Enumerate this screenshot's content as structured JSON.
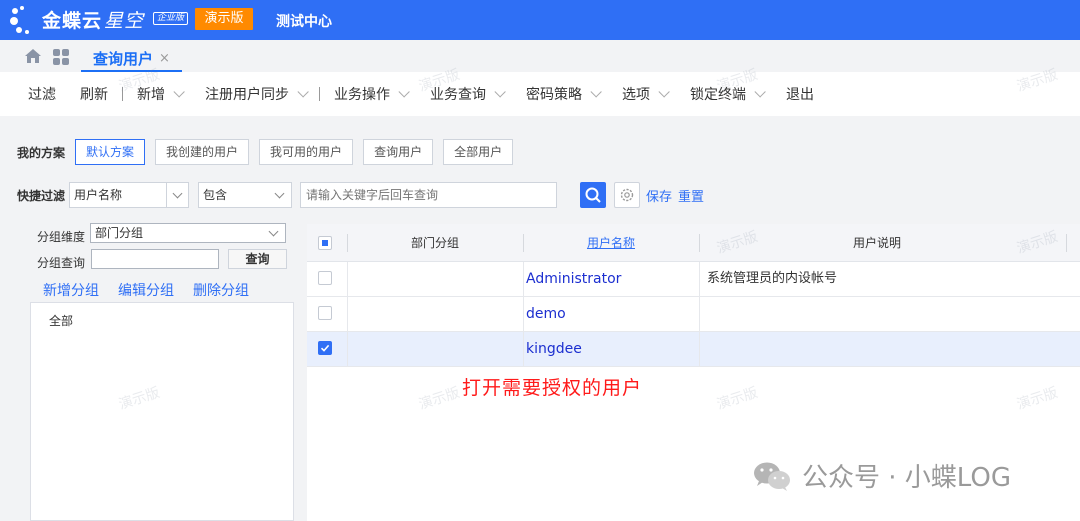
{
  "topbar": {
    "brand_main": "金蝶云",
    "brand_sub": "星空",
    "edition_badge": "企业版",
    "demo_badge": "演示版",
    "center_title": "测试中心",
    "bg_color": "#2f6ff5",
    "badge_color": "#ff8a00"
  },
  "tabs": {
    "home_icon": "home-icon",
    "apps_icon": "apps-grid-icon",
    "active_tab": "查询用户",
    "close_glyph": "×"
  },
  "toolbar": {
    "items": [
      {
        "label": "过滤",
        "dropdown": false
      },
      {
        "label": "刷新",
        "dropdown": false
      },
      {
        "label": "新增",
        "dropdown": true
      },
      {
        "label": "注册用户同步",
        "dropdown": true
      },
      {
        "label": "业务操作",
        "dropdown": true
      },
      {
        "label": "业务查询",
        "dropdown": true
      },
      {
        "label": "密码策略",
        "dropdown": true
      },
      {
        "label": "选项",
        "dropdown": true
      },
      {
        "label": "锁定终端",
        "dropdown": true
      },
      {
        "label": "退出",
        "dropdown": false
      }
    ]
  },
  "scheme": {
    "label": "我的方案",
    "buttons": [
      "默认方案",
      "我创建的用户",
      "我可用的用户",
      "查询用户",
      "全部用户"
    ],
    "active_index": 0
  },
  "quick_filter": {
    "label": "快捷过滤",
    "field": "用户名称",
    "operator": "包含",
    "placeholder": "请输入关键字后回车查询",
    "save": "保存",
    "reset": "重置"
  },
  "group_panel": {
    "dimension_label": "分组维度",
    "dimension_value": "部门分组",
    "query_label": "分组查询",
    "query_value": "",
    "query_button": "查询",
    "actions": [
      "新增分组",
      "编辑分组",
      "删除分组"
    ],
    "tree_root": "全部"
  },
  "grid": {
    "columns": [
      "部门分组",
      "用户名称",
      "用户说明"
    ],
    "rows": [
      {
        "dept": "",
        "name": "Administrator",
        "desc": "系统管理员的内设帐号",
        "checked": false
      },
      {
        "dept": "",
        "name": "demo",
        "desc": "",
        "checked": false
      },
      {
        "dept": "",
        "name": "kingdee",
        "desc": "",
        "checked": true
      }
    ]
  },
  "annotation": "打开需要授权的用户",
  "watermark_text": "演示版",
  "wechat_footer": {
    "text": "公众号 · 小蝶LOG",
    "icon": "wechat-icon"
  }
}
